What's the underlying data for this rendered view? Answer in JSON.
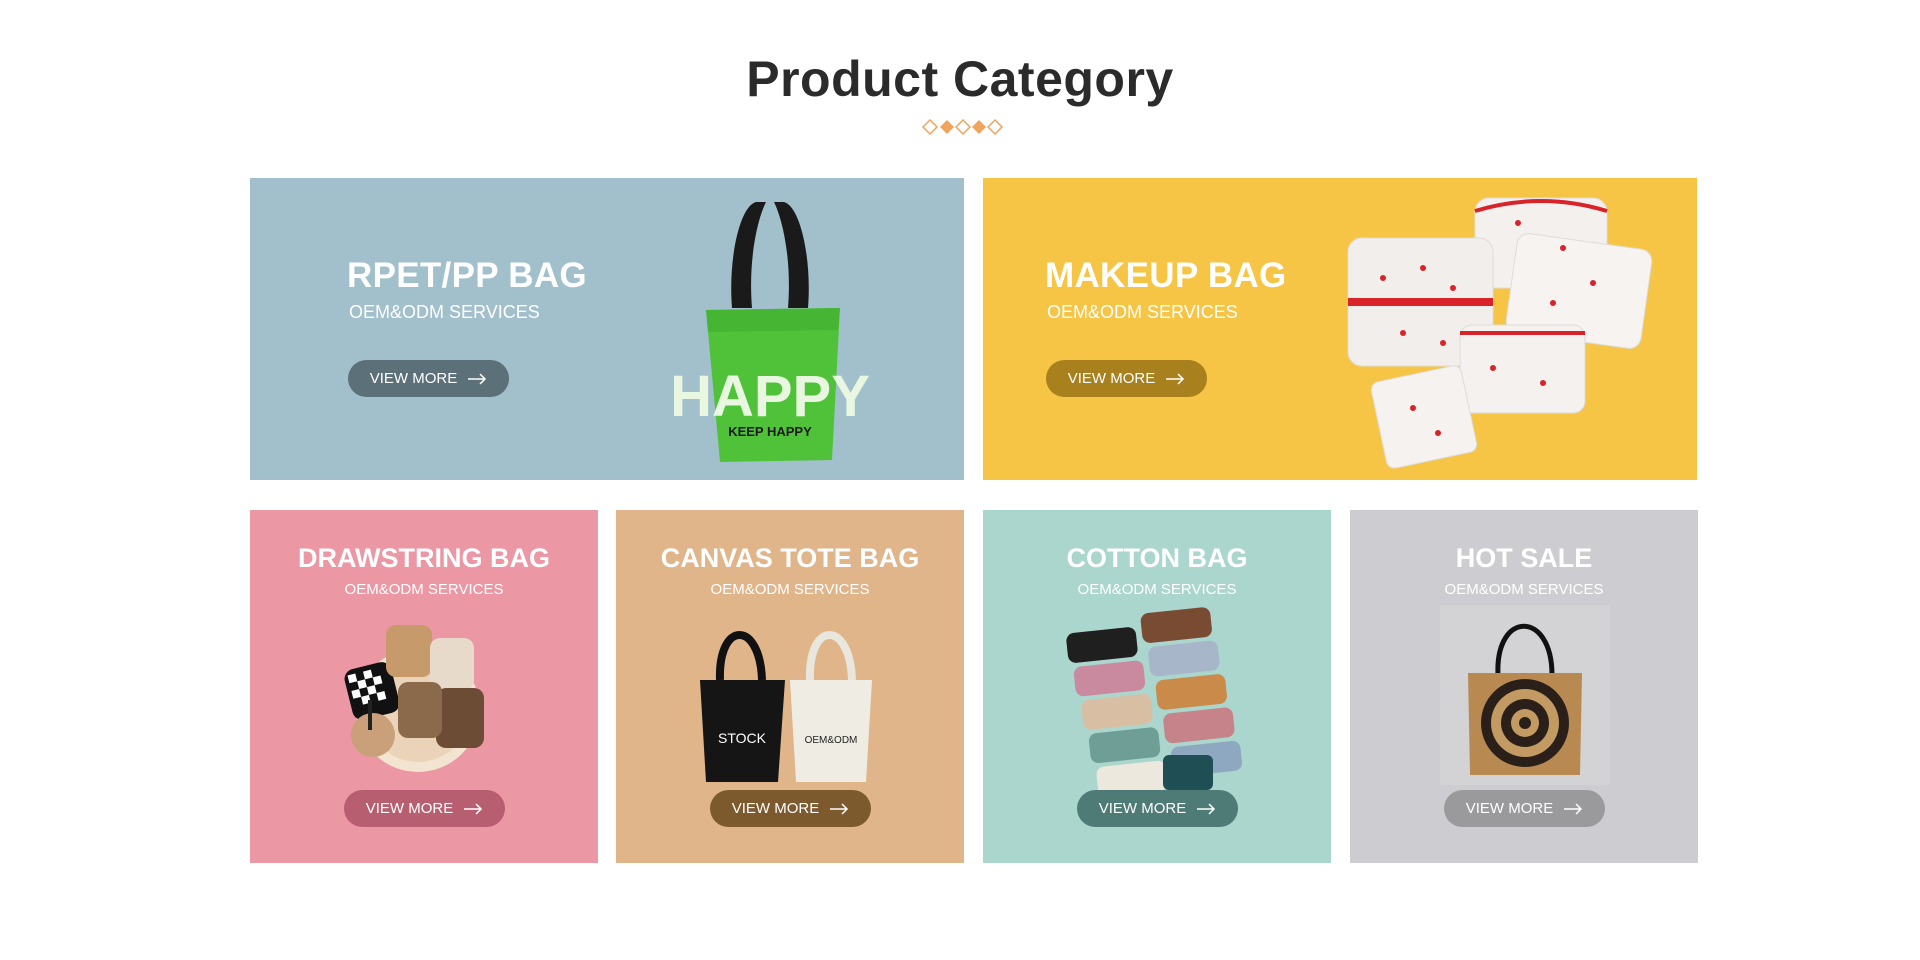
{
  "header": {
    "title": "Product Category"
  },
  "colors": {
    "accent": "#f0a35c",
    "blue_card": "#a2c0cc",
    "yellow_card": "#f7c545",
    "pink_card": "#eb97a4",
    "tan_card": "#e0b58a",
    "teal_card": "#aad6cd",
    "gray_card": "#cdcdd1"
  },
  "cards": [
    {
      "title": "RPET/PP BAG",
      "subtitle": "OEM&ODM SERVICES",
      "button": "VIEW MORE",
      "image_text": "HAPPY",
      "image_subtext": "KEEP HAPPY"
    },
    {
      "title": "MAKEUP BAG",
      "subtitle": "OEM&ODM SERVICES",
      "button": "VIEW MORE"
    },
    {
      "title": "DRAWSTRING BAG",
      "subtitle": "OEM&ODM SERVICES",
      "button": "VIEW MORE"
    },
    {
      "title": "CANVAS TOTE BAG",
      "subtitle": "OEM&ODM SERVICES",
      "button": "VIEW MORE",
      "image_label_left": "STOCK",
      "image_label_right": "OEM&ODM"
    },
    {
      "title": "COTTON BAG",
      "subtitle": "OEM&ODM SERVICES",
      "button": "VIEW MORE"
    },
    {
      "title": "HOT SALE",
      "subtitle": "OEM&ODM SERVICES",
      "button": "VIEW MORE"
    }
  ]
}
